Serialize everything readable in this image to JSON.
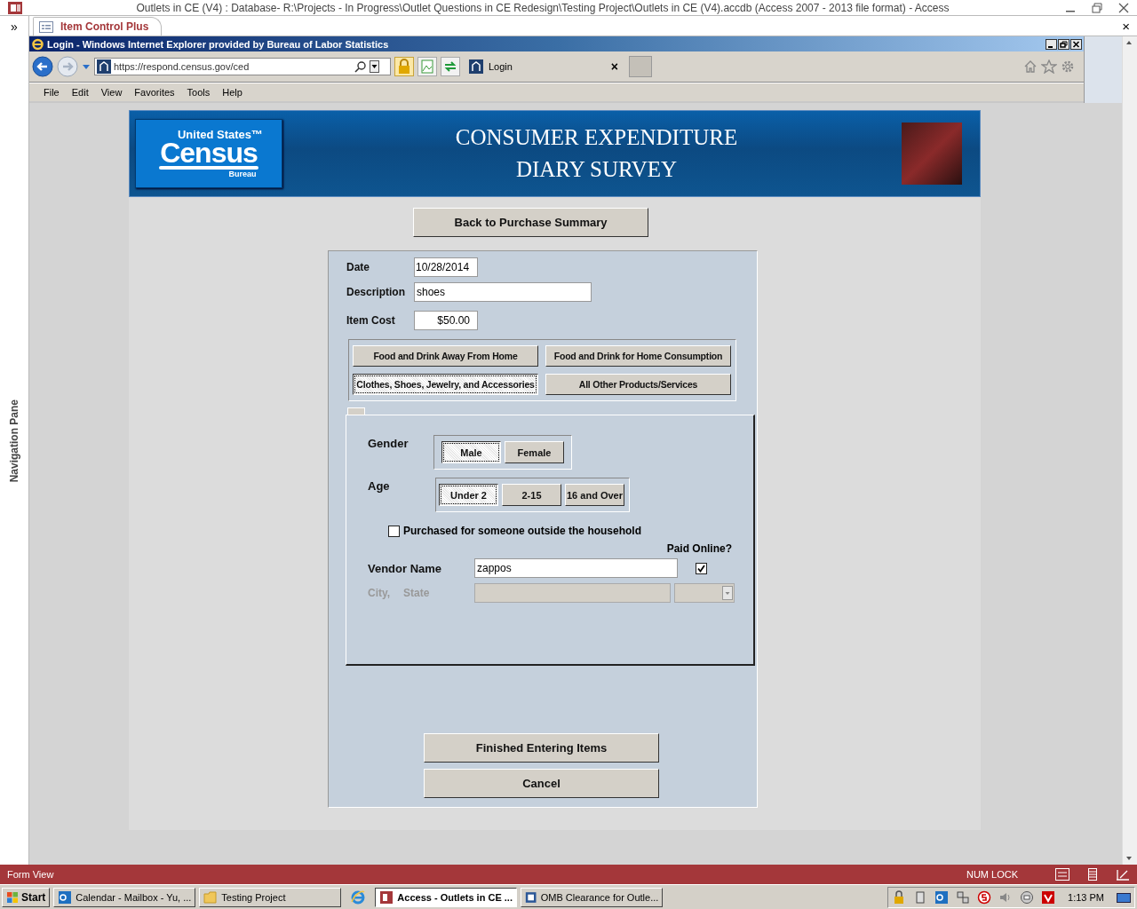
{
  "window": {
    "title": "Outlets in CE (V4) : Database- R:\\Projects - In Progress\\Outlet Questions in CE Redesign\\Testing Project\\Outlets in CE (V4).accdb (Access 2007 - 2013 file format) - Access"
  },
  "navigation_pane": {
    "toggle": "»",
    "label": "Navigation Pane"
  },
  "document_tab": {
    "label": "Item Control Plus",
    "close": "×"
  },
  "browser": {
    "title": "Login - Windows Internet Explorer provided by Bureau of Labor Statistics",
    "address": "https://respond.census.gov/ced",
    "tab": {
      "label": "Login",
      "close": "×"
    },
    "menu": [
      {
        "label": "File"
      },
      {
        "label": "Edit"
      },
      {
        "label": "View"
      },
      {
        "label": "Favorites"
      },
      {
        "label": "Tools"
      },
      {
        "label": "Help"
      }
    ]
  },
  "header": {
    "logo": {
      "top": "United States™",
      "main": "Census",
      "bottom": "Bureau"
    },
    "title_lines": [
      "CONSUMER EXPENDITURE",
      "DIARY SURVEY"
    ]
  },
  "back_button": "Back to Purchase Summary",
  "fields": [
    {
      "label": "Date",
      "value": "10/28/2014",
      "kind": "short"
    },
    {
      "label": "Description",
      "value": "shoes",
      "kind": "wide"
    },
    {
      "label": "Item Cost",
      "value": "$50.00",
      "kind": "money"
    }
  ],
  "categories": [
    {
      "label": "Food and Drink Away From Home",
      "selected": false
    },
    {
      "label": "Food and Drink for Home Consumption",
      "selected": false
    },
    {
      "label": "Clothes, Shoes, Jewelry, and Accessories",
      "selected": true
    },
    {
      "label": "All Other Products/Services",
      "selected": false
    }
  ],
  "gender": {
    "label": "Gender",
    "options": [
      {
        "label": "Male",
        "selected": true
      },
      {
        "label": "Female",
        "selected": false
      }
    ]
  },
  "age": {
    "label": "Age",
    "options": [
      {
        "label": "Under 2",
        "selected": true
      },
      {
        "label": "2-15",
        "selected": false
      },
      {
        "label": "16 and Over",
        "selected": false
      }
    ]
  },
  "outside_household": {
    "label": "Purchased for someone outside the household",
    "checked": false
  },
  "paid_online": {
    "label": "Paid Online?",
    "checked": true
  },
  "vendor": {
    "label": "Vendor Name",
    "value": "zappos"
  },
  "city_state": {
    "city_label": "City,",
    "state_label": "State",
    "disabled": true
  },
  "bottom_buttons": [
    "Finished Entering Items",
    "Cancel"
  ],
  "status_bar": {
    "left": "Form View",
    "num_lock": "NUM LOCK"
  },
  "taskbar": {
    "start": "Start",
    "items": [
      {
        "label": "Calendar - Mailbox - Yu, ...",
        "kind": "outlook",
        "selected": false
      },
      {
        "label": "Testing Project",
        "kind": "folder",
        "selected": false
      },
      {
        "label": "Access - Outlets in CE ...",
        "kind": "access",
        "selected": true
      },
      {
        "label": "OMB Clearance for Outle...",
        "kind": "word",
        "selected": false
      }
    ],
    "time": "1:13 PM"
  }
}
